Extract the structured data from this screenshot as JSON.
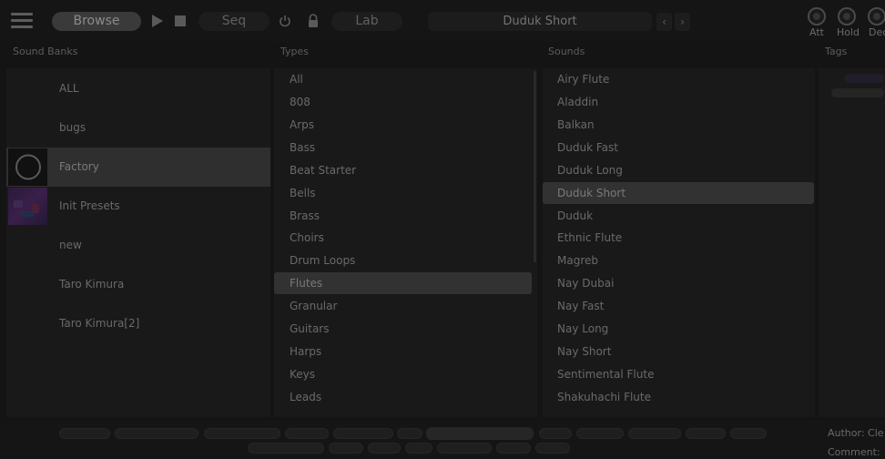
{
  "header": {
    "browse_label": "Browse",
    "seq_label": "Seq",
    "lab_label": "Lab",
    "preset_name": "Duduk Short",
    "prev_label": "‹",
    "next_label": "›",
    "knobs": [
      {
        "label": "Att"
      },
      {
        "label": "Hold"
      },
      {
        "label": "Dec"
      }
    ]
  },
  "columns": {
    "banks": "Sound Banks",
    "types": "Types",
    "sounds": "Sounds",
    "tags": "Tags"
  },
  "banks": [
    {
      "label": "ALL"
    },
    {
      "label": "bugs"
    },
    {
      "label": "Factory"
    },
    {
      "label": "Init Presets"
    },
    {
      "label": "new"
    },
    {
      "label": "Taro Kimura"
    },
    {
      "label": "Taro Kimura[2]"
    }
  ],
  "selected_bank": "Factory",
  "types": [
    "All",
    "808",
    "Arps",
    "Bass",
    "Beat Starter",
    "Bells",
    "Brass",
    "Choirs",
    "Drum Loops",
    "Flutes",
    "Granular",
    "Guitars",
    "Harps",
    "Keys",
    "Leads"
  ],
  "selected_type": "Flutes",
  "sounds": [
    "Airy Flute",
    "Aladdin",
    "Balkan",
    "Duduk Fast",
    "Duduk Long",
    "Duduk Short",
    "Duduk",
    "Ethnic Flute",
    "Magreb",
    "Nay Dubai",
    "Nay Fast",
    "Nay Long",
    "Nay Short",
    "Sentimental Flute",
    "Shakuhachi Flute"
  ],
  "selected_sound": "Duduk Short",
  "footer": {
    "author_label": "Author: Cle",
    "comment_label": "Comment:"
  },
  "icons": {
    "menu": "menu-icon",
    "play": "play-icon",
    "stop": "stop-icon",
    "power": "power-icon",
    "lock": "lock-icon"
  },
  "colors": {
    "background": "#141414",
    "panel": "#191919",
    "selection": "#323232",
    "text": "#6a6a6a"
  }
}
